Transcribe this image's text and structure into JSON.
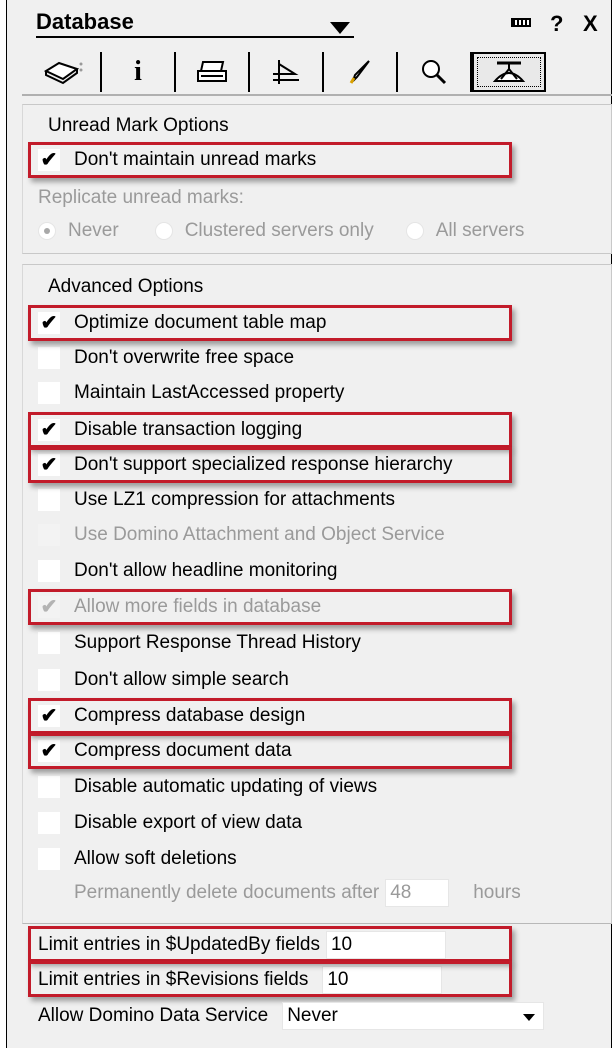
{
  "header": {
    "title": "Database",
    "minimize_icon": "menu-bar-icon",
    "help_label": "?",
    "close_label": "X"
  },
  "tabs": [
    {
      "name": "basics",
      "icon": "database-icon"
    },
    {
      "name": "info",
      "icon": "info-icon",
      "label": "i"
    },
    {
      "name": "print",
      "icon": "printer-icon"
    },
    {
      "name": "design",
      "icon": "design-icon"
    },
    {
      "name": "launch",
      "icon": "rocket-icon"
    },
    {
      "name": "full-text",
      "icon": "magnifier-icon"
    },
    {
      "name": "advanced",
      "icon": "propeller-hat-icon",
      "active": true
    }
  ],
  "unread": {
    "section_title": "Unread Mark Options",
    "dont_maintain_label": "Don't maintain unread marks",
    "replicate_label": "Replicate unread marks:",
    "radio_never": "Never",
    "radio_clustered": "Clustered servers only",
    "radio_all": "All servers"
  },
  "advanced": {
    "section_title": "Advanced Options",
    "options": [
      "Optimize document table map",
      "Don't overwrite free space",
      "Maintain LastAccessed property",
      "Disable transaction logging",
      "Don't support specialized response hierarchy",
      "Use LZ1 compression for attachments",
      "Use Domino Attachment and Object Service",
      "Don't allow headline monitoring",
      "Allow more fields in database",
      "Support Response Thread History",
      "Don't allow simple search",
      "Compress database design",
      "Compress document data",
      "Disable automatic updating of views",
      "Disable export of view data",
      "Allow soft deletions"
    ],
    "checked_mark": "✔",
    "delete_prefix": "Permanently delete documents after",
    "delete_value": "48",
    "delete_suffix": "hours"
  },
  "limits": {
    "updatedby_label": "Limit entries in $UpdatedBy fields",
    "updatedby_value": "10",
    "revisions_label": "Limit entries in $Revisions fields",
    "revisions_value": "10",
    "dds_label": "Allow Domino Data Service",
    "dds_value": "Never"
  },
  "colors": {
    "highlight": "#c21b2a",
    "panel": "#f0f0f0",
    "disabled_text": "#9a9a9a"
  }
}
